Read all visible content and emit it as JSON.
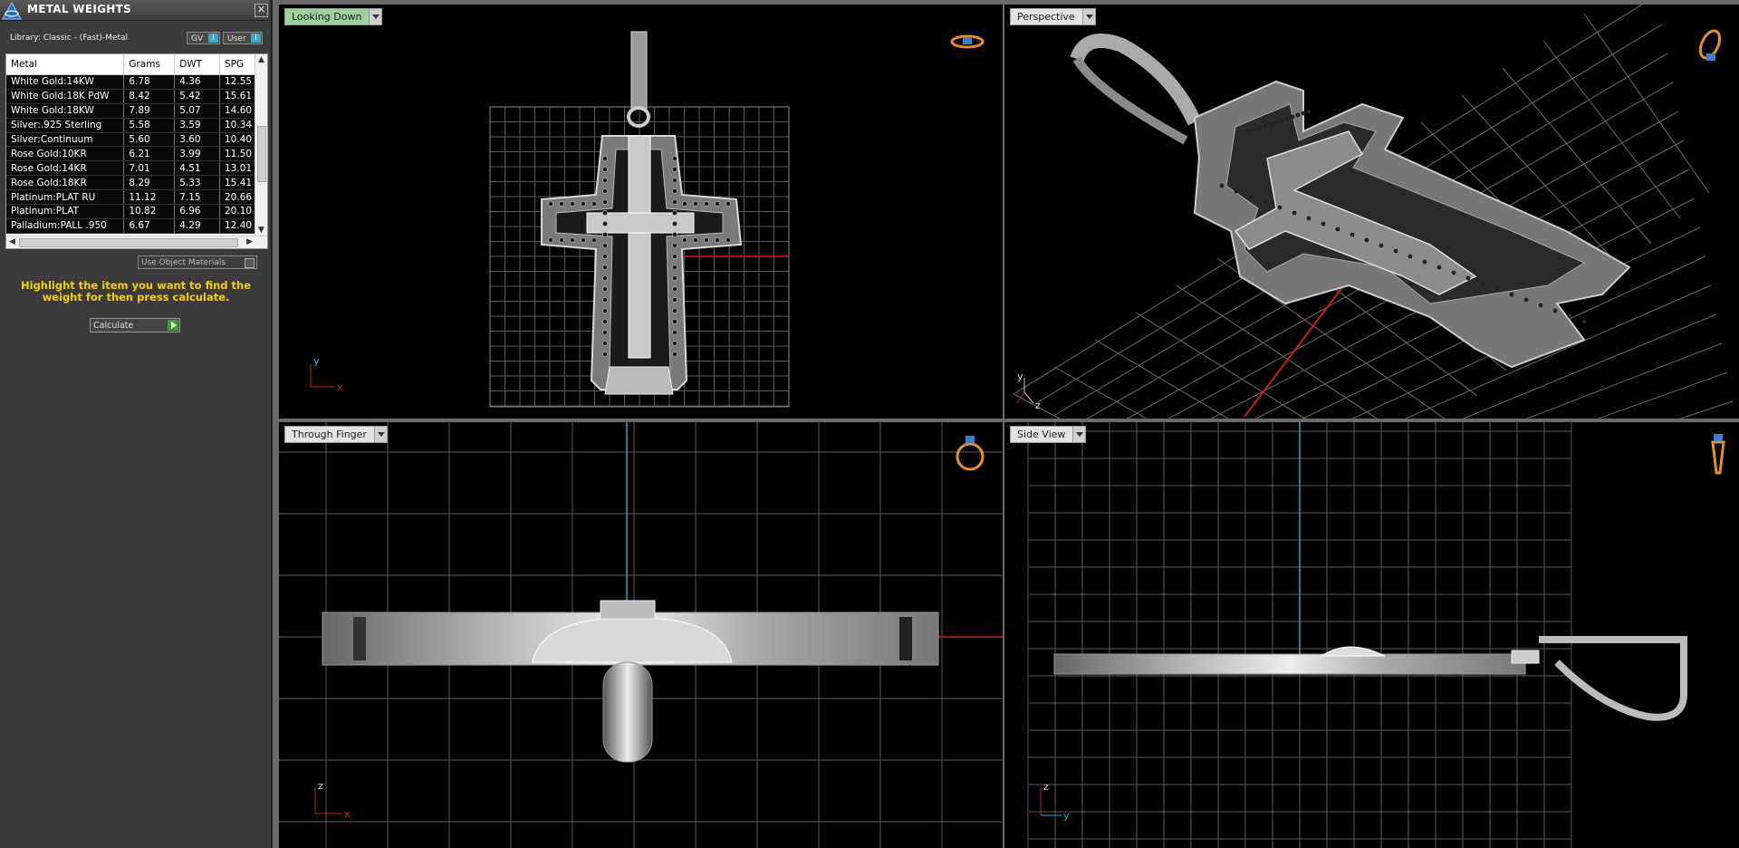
{
  "panel": {
    "title": "METAL WEIGHTS",
    "close_glyph": "✕",
    "library_label": "Library: Classic - (Fast)-Metal",
    "gv_label": "GV",
    "user_label": "User",
    "toggle_glyph": "I",
    "table": {
      "headers": [
        "Metal",
        "Grams",
        "DWT",
        "SPG"
      ],
      "rows": [
        [
          "White Gold:14KW",
          "6.78",
          "4.36",
          "12.55"
        ],
        [
          "White Gold:18K PdW",
          "8.42",
          "5.42",
          "15.61"
        ],
        [
          "White Gold:18KW",
          "7.89",
          "5.07",
          "14.60"
        ],
        [
          "Silver:.925 Sterling",
          "5.58",
          "3.59",
          "10.34"
        ],
        [
          "Silver:Continuum",
          "5.60",
          "3.60",
          "10.40"
        ],
        [
          "Rose Gold:10KR",
          "6.21",
          "3.99",
          "11.50"
        ],
        [
          "Rose Gold:14KR",
          "7.01",
          "4.51",
          "13.01"
        ],
        [
          "Rose Gold:18KR",
          "8.29",
          "5.33",
          "15.41"
        ],
        [
          "Platinum:PLAT RU",
          "11.12",
          "7.15",
          "20.66"
        ],
        [
          "Platinum:PLAT",
          "10.82",
          "6.96",
          "20.10"
        ],
        [
          "Palladium:PALL .950",
          "6.67",
          "4.29",
          "12.40"
        ]
      ]
    },
    "use_object_materials": "Use Object Materials",
    "hint": "Highlight the item you want to find the weight for then press calculate.",
    "calculate_label": "Calculate"
  },
  "viewports": {
    "top_left": {
      "label": "Looking Down",
      "axis_a": "y",
      "axis_b": "x",
      "icon": "ring-top-icon"
    },
    "top_right": {
      "label": "Perspective",
      "axis_a": "y",
      "axis_b": "z",
      "icon": "ring-perspective-icon"
    },
    "bottom_left": {
      "label": "Through Finger",
      "axis_a": "z",
      "axis_b": "x",
      "icon": "ring-front-icon"
    },
    "bottom_right": {
      "label": "Side View",
      "axis_a": "z",
      "axis_b": "y",
      "icon": "ring-side-icon"
    }
  },
  "colors": {
    "active_label": "#9fce9f",
    "hint_text": "#f5d000",
    "grid": "#555555",
    "axis_red": "#c82020",
    "axis_cyan": "#2aa6c0",
    "icon_orange": "#e89020"
  }
}
